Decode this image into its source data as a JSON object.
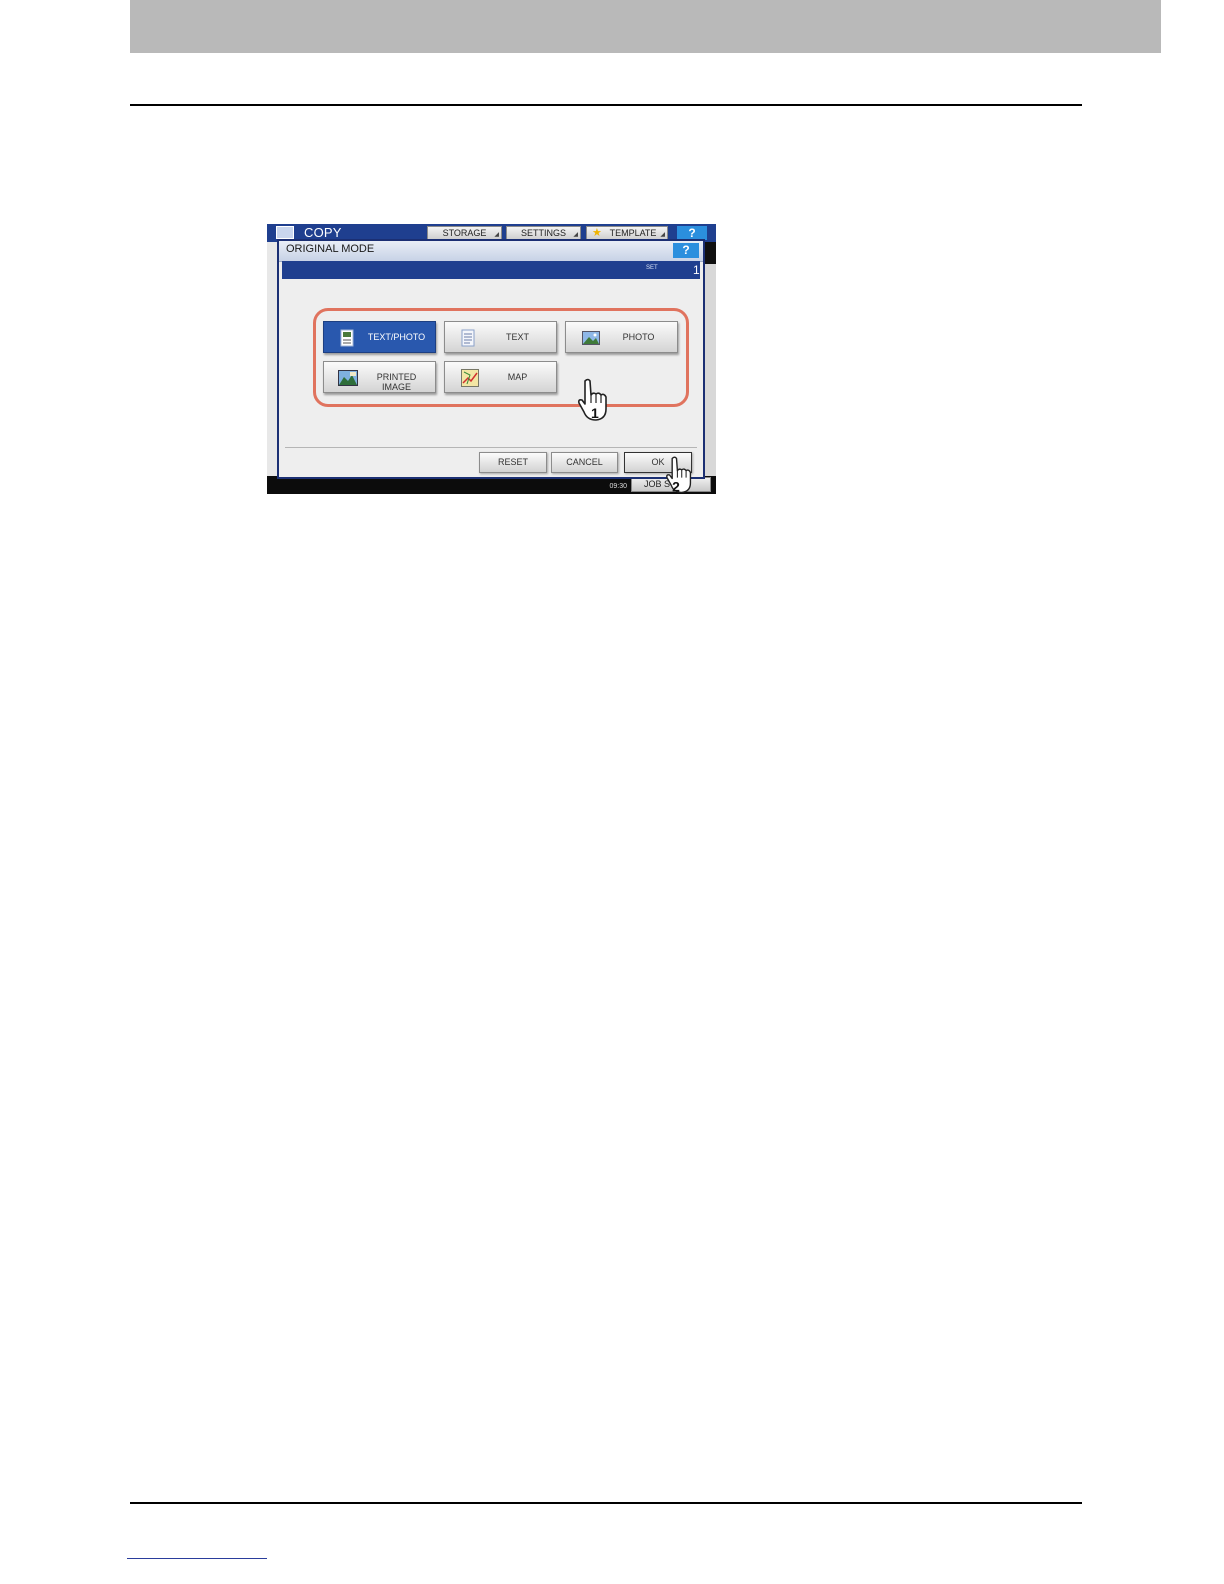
{
  "screen": {
    "app_title": "COPY",
    "tabs": [
      {
        "label": "STORAGE"
      },
      {
        "label": "SETTINGS"
      },
      {
        "label": "TEMPLATE"
      }
    ],
    "help_label": "?",
    "clock_text": "09:30",
    "job_status_label": "JOB S"
  },
  "dialog": {
    "title": "ORIGINAL MODE",
    "help_label": "?",
    "set_label": "SET",
    "set_value": "1",
    "modes": [
      {
        "label": "TEXT/PHOTO",
        "icon": "text-photo-icon",
        "selected": true
      },
      {
        "label": "TEXT",
        "icon": "text-document-icon",
        "selected": false
      },
      {
        "label": "PHOTO",
        "icon": "photo-icon",
        "selected": false
      },
      {
        "label": "PRINTED IMAGE",
        "icon": "printed-image-icon",
        "selected": false
      },
      {
        "label": "MAP",
        "icon": "map-icon",
        "selected": false
      }
    ],
    "actions": {
      "reset": "RESET",
      "cancel": "CANCEL",
      "ok": "OK"
    }
  },
  "annotations": {
    "step1": "1",
    "step2": "2",
    "highlight_color": "#e0735e"
  },
  "colors": {
    "header_band": "#b9b9b9",
    "selected_mode": "#2958ae",
    "title_bar": "#1f3f8f"
  }
}
